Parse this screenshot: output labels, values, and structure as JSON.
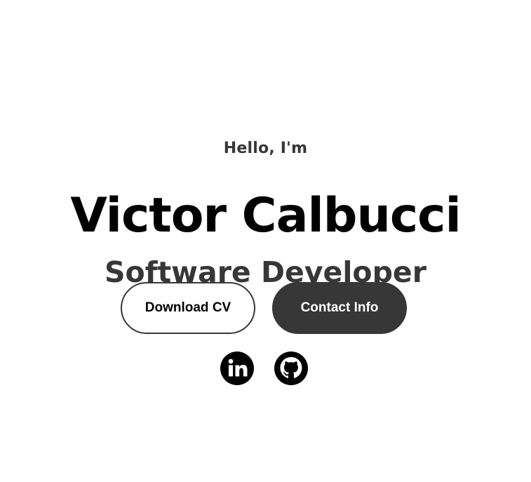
{
  "hero": {
    "greeting": "Hello, I'm",
    "name": "Victor Calbucci",
    "title": "Software Developer"
  },
  "buttons": {
    "download_cv": "Download CV",
    "contact_info": "Contact Info"
  },
  "socials": [
    {
      "name": "LinkedIn",
      "icon": "linkedin-icon"
    },
    {
      "name": "GitHub",
      "icon": "github-icon"
    }
  ],
  "colors": {
    "background": "#ffffff",
    "text_primary": "#000000",
    "text_secondary": "#373737",
    "button_dark": "#373737",
    "button_light_text": "#ffffff"
  }
}
